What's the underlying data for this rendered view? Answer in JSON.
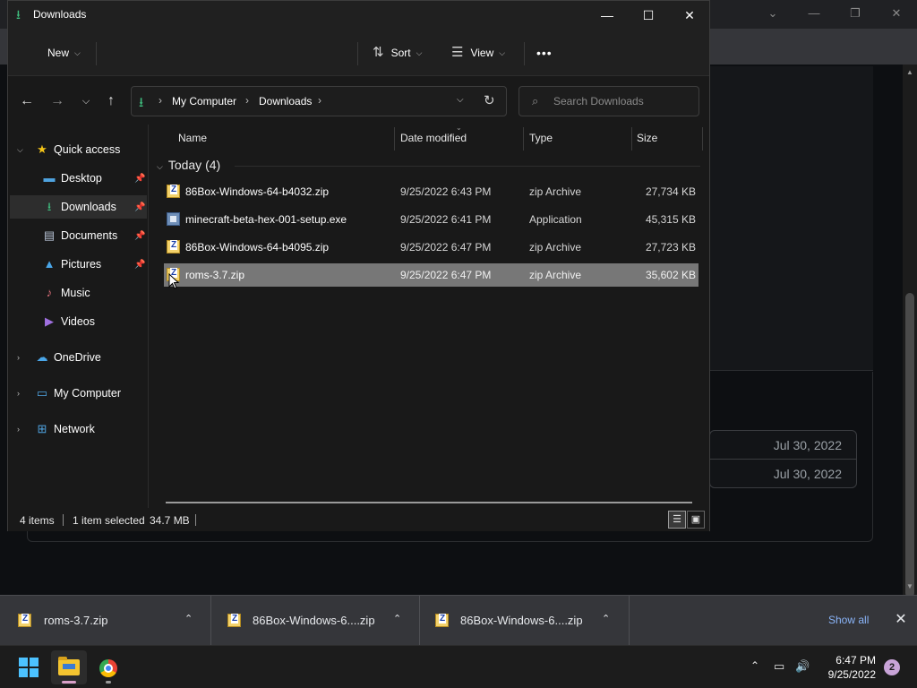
{
  "explorer": {
    "title": "Downloads",
    "toolbar": {
      "new_label": "New",
      "sort_label": "Sort",
      "view_label": "View",
      "more_label": "•••"
    },
    "breadcrumb": [
      "My Computer",
      "Downloads"
    ],
    "search_placeholder": "Search Downloads",
    "sidebar": {
      "quick_access": "Quick access",
      "items": [
        {
          "label": "Desktop",
          "icon": "desktop-icon",
          "pinned": true
        },
        {
          "label": "Downloads",
          "icon": "download-icon",
          "pinned": true,
          "active": true
        },
        {
          "label": "Documents",
          "icon": "documents-icon",
          "pinned": true
        },
        {
          "label": "Pictures",
          "icon": "pictures-icon",
          "pinned": true
        },
        {
          "label": "Music",
          "icon": "music-icon",
          "pinned": false
        },
        {
          "label": "Videos",
          "icon": "videos-icon",
          "pinned": false
        }
      ],
      "onedrive": "OneDrive",
      "my_computer": "My Computer",
      "network": "Network"
    },
    "columns": {
      "name": "Name",
      "date": "Date modified",
      "type": "Type",
      "size": "Size"
    },
    "group_label": "Today (4)",
    "files": [
      {
        "name": "86Box-Windows-64-b4032.zip",
        "date": "9/25/2022 6:43 PM",
        "type": "zip Archive",
        "size": "27,734 KB",
        "icon": "zip-icon"
      },
      {
        "name": "minecraft-beta-hex-001-setup.exe",
        "date": "9/25/2022 6:41 PM",
        "type": "Application",
        "size": "45,315 KB",
        "icon": "exe-icon"
      },
      {
        "name": "86Box-Windows-64-b4095.zip",
        "date": "9/25/2022 6:47 PM",
        "type": "zip Archive",
        "size": "27,723 KB",
        "icon": "zip-icon"
      },
      {
        "name": "roms-3.7.zip",
        "date": "9/25/2022 6:47 PM",
        "type": "zip Archive",
        "size": "35,602 KB",
        "icon": "zip-icon",
        "selected": true
      }
    ],
    "status": {
      "items": "4 items",
      "selected": "1 item selected",
      "selected_size": "34.7 MB"
    }
  },
  "chrome_bg": {
    "dates": [
      "Jul 30, 2022",
      "Jul 30, 2022"
    ]
  },
  "shelf": {
    "downloads": [
      "roms-3.7.zip",
      "86Box-Windows-6....zip",
      "86Box-Windows-6....zip"
    ],
    "show_all": "Show all"
  },
  "taskbar": {
    "time": "6:47 PM",
    "date": "9/25/2022",
    "notifications": "2"
  },
  "colors": {
    "accent_download": "#3fbf7f",
    "selection": "#777777",
    "link": "#8ab4f8",
    "windows_blue": "#4cc2ff"
  }
}
